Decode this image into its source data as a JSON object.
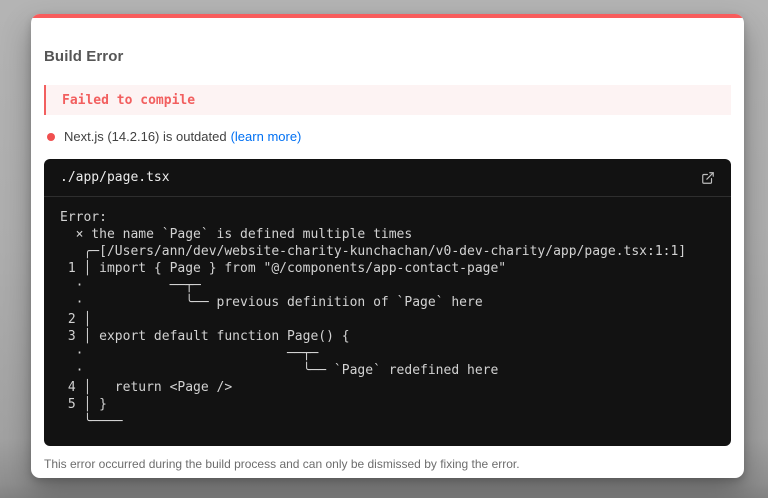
{
  "overlay": {
    "title": "Build Error",
    "error_label": "Failed to compile",
    "version_notice": {
      "text": "Next.js (14.2.16) is outdated",
      "link_label": "(learn more)"
    },
    "footer_note": "This error occurred during the build process and can only be dismissed by fixing the error."
  },
  "code_frame": {
    "file_path": "./app/page.tsx",
    "open_icon": "external-link-icon",
    "error_output": [
      "Error:",
      "  × the name `Page` is defined multiple times",
      "   ╭─[/Users/ann/dev/website-charity-kunchachan/v0-dev-charity/app/page.tsx:1:1]",
      " 1 │ import { Page } from \"@/components/app-contact-page\"",
      "  ·           ──┬─",
      "  ·             ╰── previous definition of `Page` here",
      " 2 │ ",
      " 3 │ export default function Page() {",
      "  ·                          ──┬─",
      "  ·                            ╰── `Page` redefined here",
      " 4 │   return <Page />",
      " 5 │ }",
      "   ╰────"
    ]
  },
  "colors": {
    "accent_red": "#f85c5c",
    "error_text_red": "#f25f5f",
    "link_blue": "#0070f3",
    "terminal_background": "#121212",
    "terminal_text": "#d2d2d2",
    "backdrop_gray": "#aeaeae"
  }
}
